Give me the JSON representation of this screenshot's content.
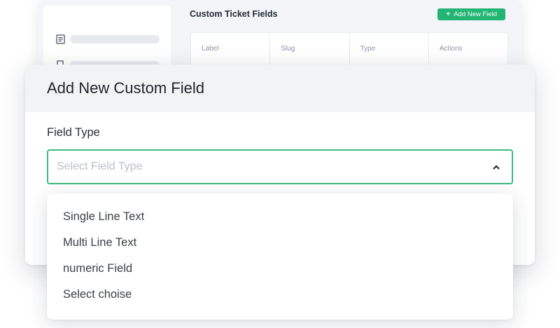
{
  "background": {
    "title": "Custom Ticket Fields",
    "add_button": {
      "icon": "plus-icon",
      "label": "Add New Field"
    },
    "sidebar_icons": [
      "document-icon",
      "bookmark-icon"
    ],
    "table_headers": [
      "Label",
      "Slug",
      "Type",
      "Actions"
    ]
  },
  "modal": {
    "title": "Add New Custom Field",
    "field_label": "Field Type",
    "select": {
      "placeholder": "Select Field Type",
      "icon": "chevron-up-icon"
    }
  },
  "dropdown": {
    "options": [
      "Single Line Text",
      "Multi Line Text",
      "numeric Field",
      "Select choise"
    ]
  },
  "colors": {
    "accent": "#22b573",
    "select_border": "#3fba82"
  }
}
